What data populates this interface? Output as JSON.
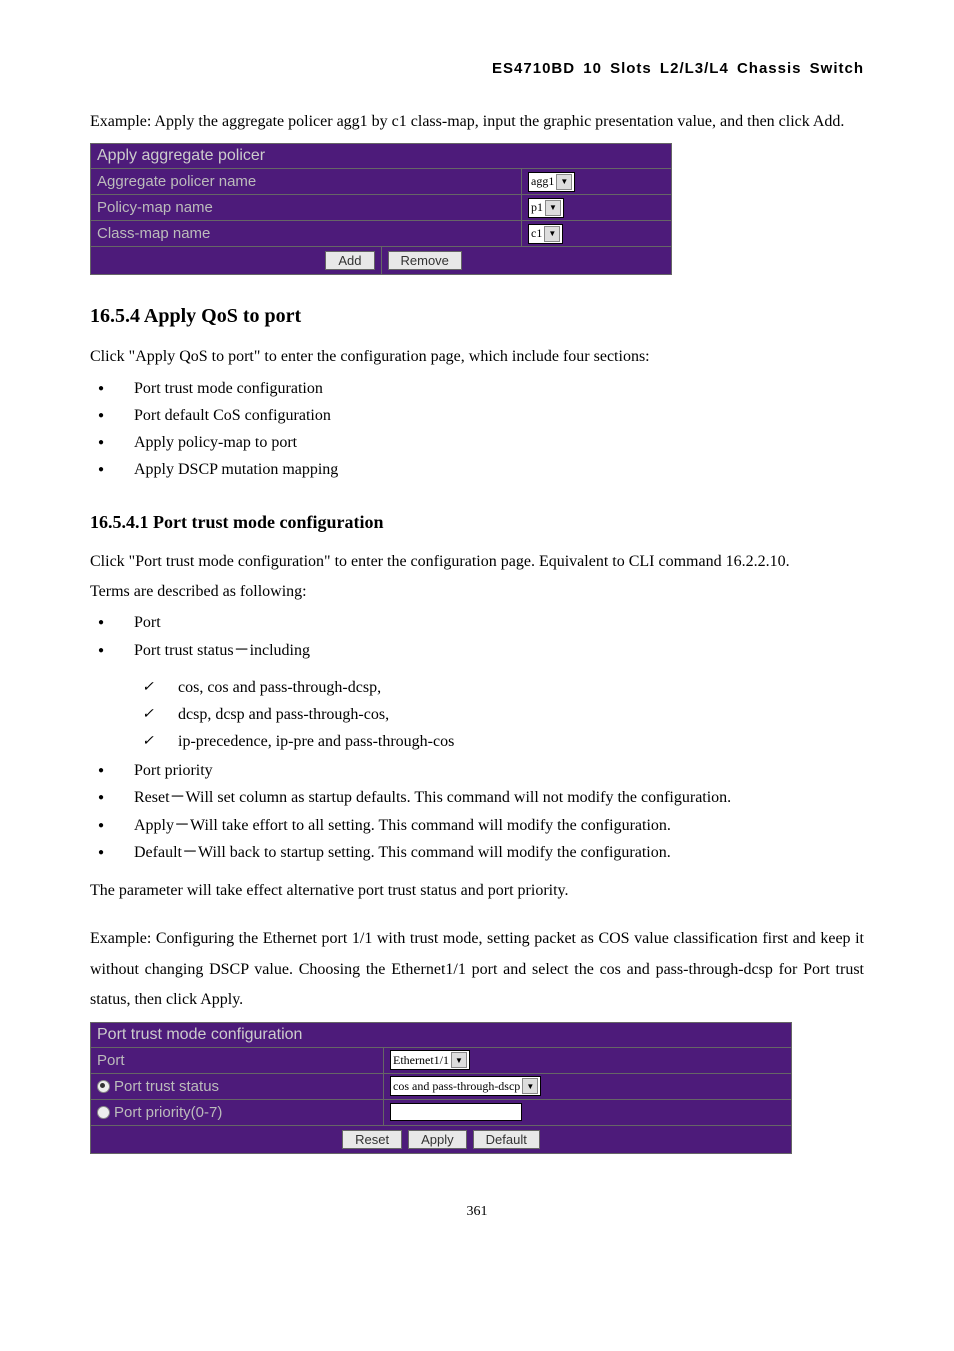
{
  "header": {
    "title": "ES4710BD 10 Slots L2/L3/L4 Chassis Switch"
  },
  "intro1": "Example: Apply the aggregate policer agg1 by c1 class-map, input the graphic presentation value, and then click Add.",
  "box1": {
    "title": "Apply aggregate policer",
    "rows": [
      {
        "label": "Aggregate policer name",
        "value": "agg1"
      },
      {
        "label": "Policy-map name",
        "value": "p1"
      },
      {
        "label": "Class-map name",
        "value": "c1"
      }
    ],
    "buttons": {
      "add": "Add",
      "remove": "Remove"
    }
  },
  "s1654": {
    "heading": "16.5.4 Apply QoS to port",
    "lead": "Click \"Apply QoS to port\" to enter the configuration page, which include four sections:",
    "items": [
      "Port trust mode configuration",
      "Port default CoS configuration",
      "Apply policy-map to port",
      "Apply DSCP mutation mapping"
    ]
  },
  "s16541": {
    "heading": "16.5.4.1 Port trust mode configuration",
    "p1": "Click \"Port trust mode configuration\" to enter the configuration page. Equivalent to CLI command 16.2.2.10.",
    "p2": "Terms are described as following:",
    "items1": [
      "Port",
      "Port trust status－including"
    ],
    "checks": [
      "cos, cos and pass-through-dcsp,",
      "dcsp, dcsp and pass-through-cos,",
      "ip-precedence, ip-pre and pass-through-cos"
    ],
    "items2": [
      "Port priority",
      "Reset－Will set column as startup defaults. This command will not modify the configuration.",
      "Apply－Will take effort to all setting. This command will modify the configuration.",
      "Default－Will back to startup setting. This command will modify the configuration."
    ],
    "p3": "The parameter will take effect alternative port trust status and port priority.",
    "p4": "Example: Configuring the Ethernet port 1/1 with trust mode, setting packet as COS value classification first and keep it without changing DSCP value. Choosing the Ethernet1/1 port and select the cos and pass-through-dcsp for Port trust status, then click Apply."
  },
  "box2": {
    "title": "Port trust mode configuration",
    "rows": {
      "port": {
        "label": "Port",
        "value": "Ethernet1/1"
      },
      "status": {
        "label": "Port trust status",
        "value": "cos and pass-through-dscp"
      },
      "priority": {
        "label": "Port priority(0-7)",
        "value": ""
      }
    },
    "buttons": {
      "reset": "Reset",
      "apply": "Apply",
      "default": "Default"
    }
  },
  "page_number": "361"
}
